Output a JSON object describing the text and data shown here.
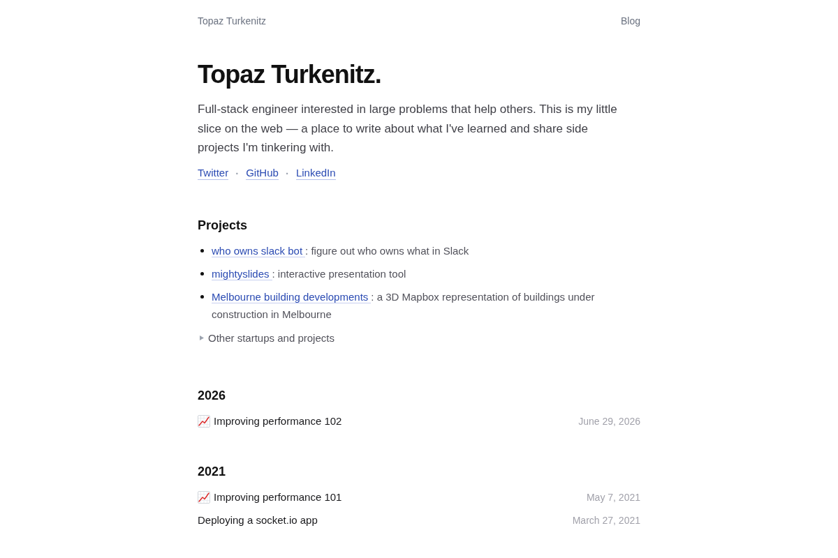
{
  "header": {
    "site_name": "Topaz Turkenitz",
    "nav": [
      {
        "label": "Blog"
      }
    ]
  },
  "intro": {
    "title": "Topaz Turkenitz.",
    "bio": "Full-stack engineer interested in large problems that help others. This is my little slice on the web — a place to write about what I've learned and share side projects I'm tinkering with.",
    "link_separator": "·",
    "links": [
      "Twitter",
      "GitHub",
      "LinkedIn"
    ]
  },
  "projects": {
    "heading": "Projects",
    "items": [
      {
        "link": "who owns slack bot",
        "description": ": figure out who owns what in Slack"
      },
      {
        "link": "mightyslides",
        "description": ": interactive presentation tool"
      },
      {
        "link": "Melbourne building developments",
        "description": ": a 3D Mapbox representation of buildings under construction in Melbourne"
      }
    ],
    "more": {
      "label": "Other startups and projects",
      "expanded": false
    }
  },
  "years": [
    {
      "year": "2026",
      "posts": [
        {
          "title": "Improving performance 102",
          "date": "June 29, 2026",
          "chart_icon": true
        }
      ]
    },
    {
      "year": "2021",
      "posts": [
        {
          "title": "Improving performance 101",
          "date": "May 7, 2021",
          "chart_icon": true
        },
        {
          "title": "Deploying a socket.io app",
          "date": "March 27, 2021",
          "chart_icon": false
        }
      ]
    }
  ]
}
